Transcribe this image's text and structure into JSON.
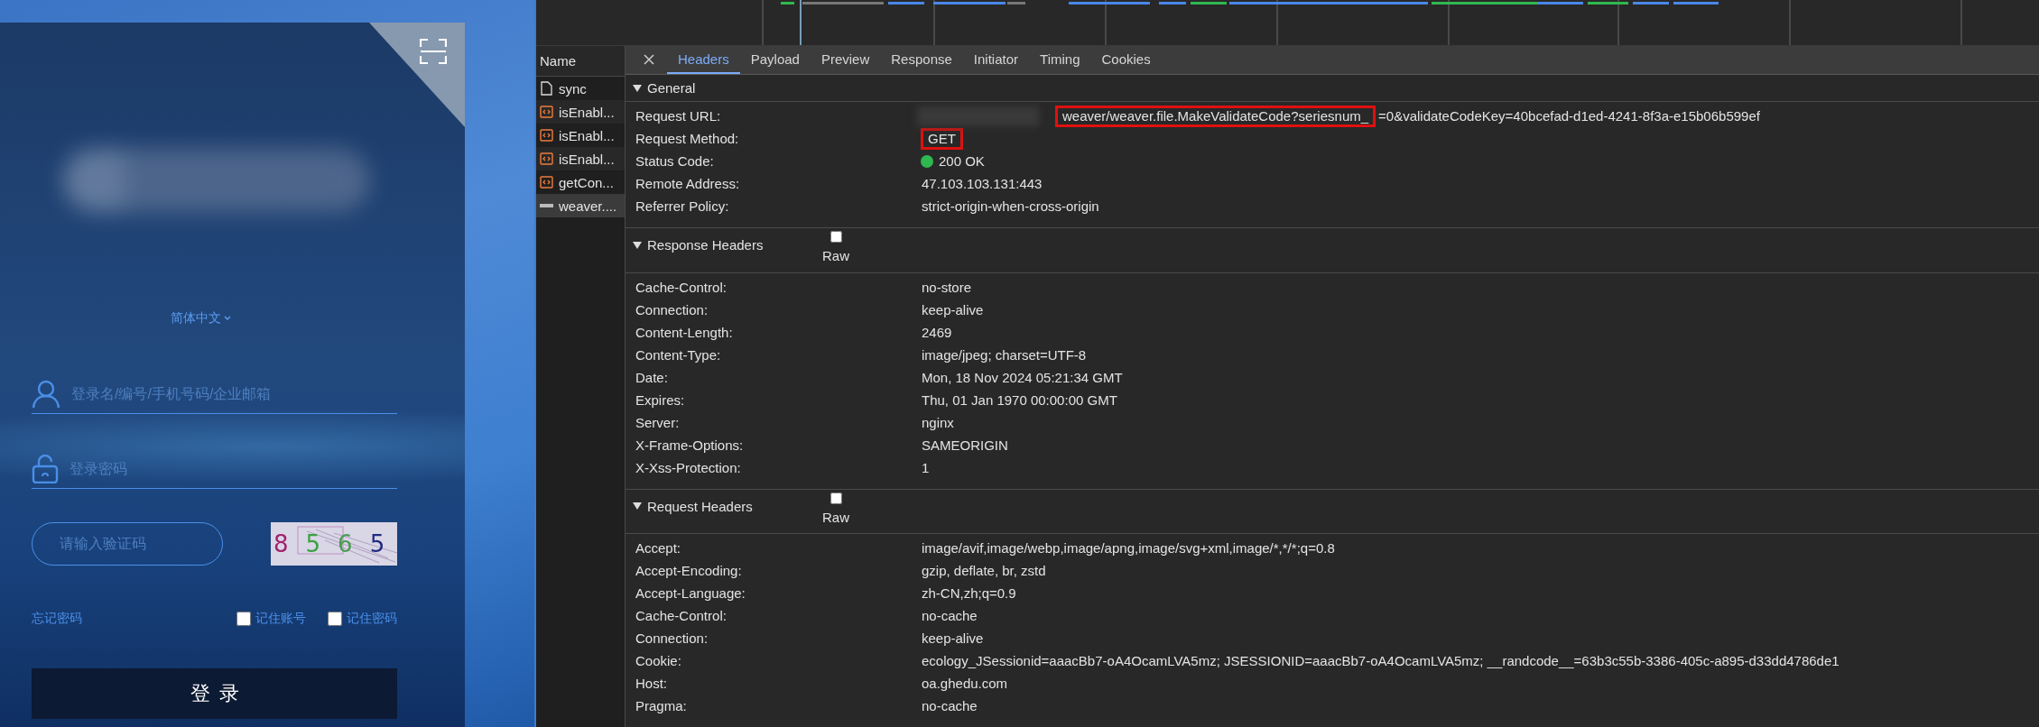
{
  "login": {
    "language": "简体中文",
    "username": {
      "placeholder": "登录名/编号/手机号码/企业邮箱"
    },
    "password": {
      "placeholder": "登录密码"
    },
    "captcha": {
      "placeholder": "请输入验证码",
      "code": "8565"
    },
    "forgot_link": "忘记密码",
    "options": [
      {
        "label": "记住账号",
        "checked": false
      },
      {
        "label": "记住密码",
        "checked": false
      }
    ],
    "submit": "登录"
  },
  "devtools": {
    "name_header": "Name",
    "requests": [
      {
        "name": "sync",
        "kind": "document",
        "selected": false
      },
      {
        "name": "isEnabl...",
        "kind": "script",
        "selected": false
      },
      {
        "name": "isEnabl...",
        "kind": "script",
        "selected": false
      },
      {
        "name": "isEnabl...",
        "kind": "script",
        "selected": false
      },
      {
        "name": "getCon...",
        "kind": "script",
        "selected": false
      },
      {
        "name": "weaver....",
        "kind": "image",
        "selected": true
      }
    ],
    "tabs": [
      {
        "label": "Headers",
        "selected": true
      },
      {
        "label": "Payload",
        "selected": false
      },
      {
        "label": "Preview",
        "selected": false
      },
      {
        "label": "Response",
        "selected": false
      },
      {
        "label": "Initiator",
        "selected": false
      },
      {
        "label": "Timing",
        "selected": false
      },
      {
        "label": "Cookies",
        "selected": false
      }
    ],
    "sections": [
      {
        "title": "General",
        "expanded": true,
        "rows": [
          {
            "name": "Request URL:",
            "redacted": true,
            "value_parts": [
              {
                "text": "weaver/weaver.file.MakeValidateCode?seriesnum_",
                "highlighted": true
              },
              {
                "text": "=0&validateCodeKey=40bcefad-d1ed-4241-8f3a-e15b06b599ef",
                "highlighted": false
              }
            ]
          },
          {
            "name": "Request Method:",
            "value_parts": [
              {
                "text": "GET",
                "highlighted": true
              }
            ]
          },
          {
            "name": "Status Code:",
            "color": "#2fb84f",
            "value_parts": [
              {
                "text": "200 OK",
                "highlighted": false
              }
            ]
          },
          {
            "name": "Remote Address:",
            "value_parts": [
              {
                "text": "47.103.103.131:443",
                "highlighted": false
              }
            ]
          },
          {
            "name": "Referrer Policy:",
            "value_parts": [
              {
                "text": "strict-origin-when-cross-origin",
                "highlighted": false
              }
            ]
          }
        ]
      },
      {
        "title": "Response Headers",
        "expanded": true,
        "raw": {
          "label": "Raw",
          "checked": false
        },
        "rows": [
          {
            "name": "Cache-Control:",
            "value": "no-store"
          },
          {
            "name": "Connection:",
            "value": "keep-alive"
          },
          {
            "name": "Content-Length:",
            "value": "2469"
          },
          {
            "name": "Content-Type:",
            "value": "image/jpeg; charset=UTF-8"
          },
          {
            "name": "Date:",
            "value": "Mon, 18 Nov 2024 05:21:34 GMT"
          },
          {
            "name": "Expires:",
            "value": "Thu, 01 Jan 1970 00:00:00 GMT"
          },
          {
            "name": "Server:",
            "value": "nginx"
          },
          {
            "name": "X-Frame-Options:",
            "value": "SAMEORIGIN"
          },
          {
            "name": "X-Xss-Protection:",
            "value": "1"
          }
        ]
      },
      {
        "title": "Request Headers",
        "expanded": true,
        "raw": {
          "label": "Raw",
          "checked": false
        },
        "rows": [
          {
            "name": "Accept:",
            "value": "image/avif,image/webp,image/apng,image/svg+xml,image/*,*/*;q=0.8"
          },
          {
            "name": "Accept-Encoding:",
            "value": "gzip, deflate, br, zstd"
          },
          {
            "name": "Accept-Language:",
            "value": "zh-CN,zh;q=0.9"
          },
          {
            "name": "Cache-Control:",
            "value": "no-cache"
          },
          {
            "name": "Connection:",
            "value": "keep-alive"
          },
          {
            "name": "Cookie:",
            "value": "ecology_JSessionid=aaacBb7-oA4OcamLVA5mz; JSESSIONID=aaacBb7-oA4OcamLVA5mz; __randcode__=63b3c55b-3386-405c-a895-d33dd4786de1"
          },
          {
            "name": "Host:",
            "value": "oa.ghedu.com"
          },
          {
            "name": "Pragma:",
            "value": "no-cache"
          }
        ]
      }
    ]
  }
}
